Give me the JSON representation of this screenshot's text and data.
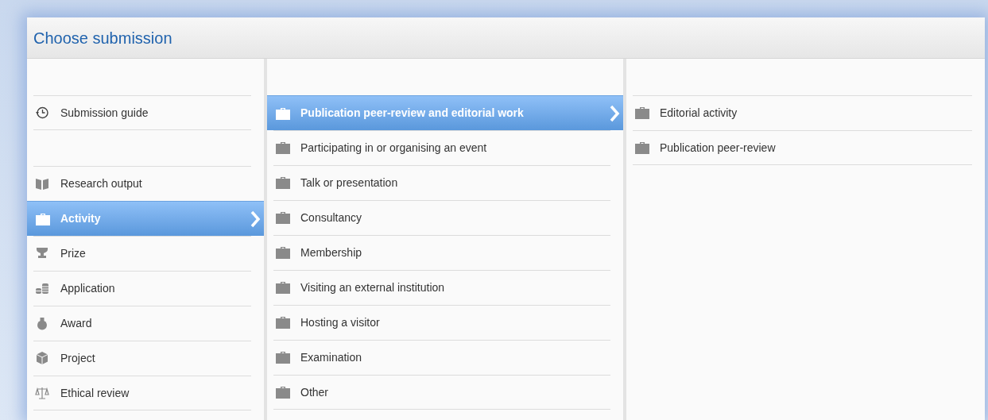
{
  "window": {
    "title": "Choose submission"
  },
  "columns": [
    {
      "groups": [
        [
          {
            "label": "Submission guide",
            "kind": "history",
            "selected": false
          }
        ],
        [
          {
            "label": "Research output",
            "kind": "book",
            "selected": false
          },
          {
            "label": "Activity",
            "kind": "briefcase",
            "selected": true
          },
          {
            "label": "Prize",
            "kind": "trophy",
            "selected": false
          },
          {
            "label": "Application",
            "kind": "coins",
            "selected": false
          },
          {
            "label": "Award",
            "kind": "bag",
            "selected": false
          },
          {
            "label": "Project",
            "kind": "cube",
            "selected": false
          },
          {
            "label": "Ethical review",
            "kind": "scales",
            "selected": false
          }
        ]
      ]
    },
    {
      "groups": [
        [
          {
            "label": "Publication peer-review and editorial work",
            "kind": "briefcase",
            "selected": true
          },
          {
            "label": "Participating in or organising an event",
            "kind": "briefcase",
            "selected": false
          },
          {
            "label": "Talk or presentation",
            "kind": "briefcase",
            "selected": false
          },
          {
            "label": "Consultancy",
            "kind": "briefcase",
            "selected": false
          },
          {
            "label": "Membership",
            "kind": "briefcase",
            "selected": false
          },
          {
            "label": "Visiting an external institution",
            "kind": "briefcase",
            "selected": false
          },
          {
            "label": "Hosting a visitor",
            "kind": "briefcase",
            "selected": false
          },
          {
            "label": "Examination",
            "kind": "briefcase",
            "selected": false
          },
          {
            "label": "Other",
            "kind": "briefcase",
            "selected": false
          }
        ]
      ]
    },
    {
      "groups": [
        [
          {
            "label": "Editorial activity",
            "kind": "briefcase",
            "selected": false
          },
          {
            "label": "Publication peer-review",
            "kind": "briefcase",
            "selected": false
          }
        ]
      ]
    }
  ]
}
